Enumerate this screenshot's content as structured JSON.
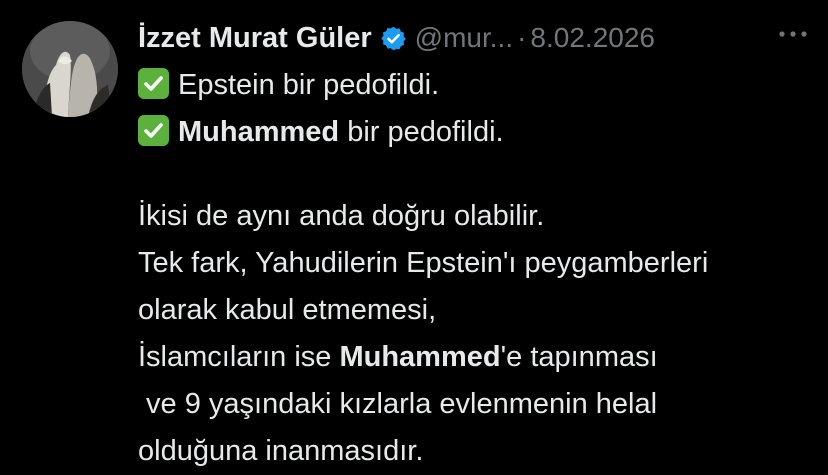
{
  "author": {
    "display_name": "İzzet Murat Güler",
    "handle": "@mur...",
    "separator": "·",
    "date": "8.02.2026",
    "verified": true,
    "avatar_icon": "avatar-image"
  },
  "colors": {
    "background": "#000000",
    "text": "#e7e9ea",
    "muted": "#71767b",
    "verified_badge": "#1d9bf0",
    "check_badge": "#5bb13b"
  },
  "more_icon": "more-horizontal-icon",
  "tweet": {
    "line1": {
      "check": "✅",
      "text": "Epstein bir pedofildi."
    },
    "line2": {
      "check": "✅",
      "bold": "Muhammed",
      "rest": " bir pedofildi."
    },
    "line3": "İkisi de aynı anda doğru olabilir.",
    "line4": "Tek fark, Yahudilerin Epstein'ı peygamberleri",
    "line5": "olarak kabul etmemesi,",
    "line6": {
      "pre": "İslamcıların ise ",
      "bold": "Muhammed",
      "post": "'e tapınması"
    },
    "line7": " ve 9 yaşındaki kızlarla evlenmenin helal",
    "line8": "olduğuna inanmasıdır."
  }
}
